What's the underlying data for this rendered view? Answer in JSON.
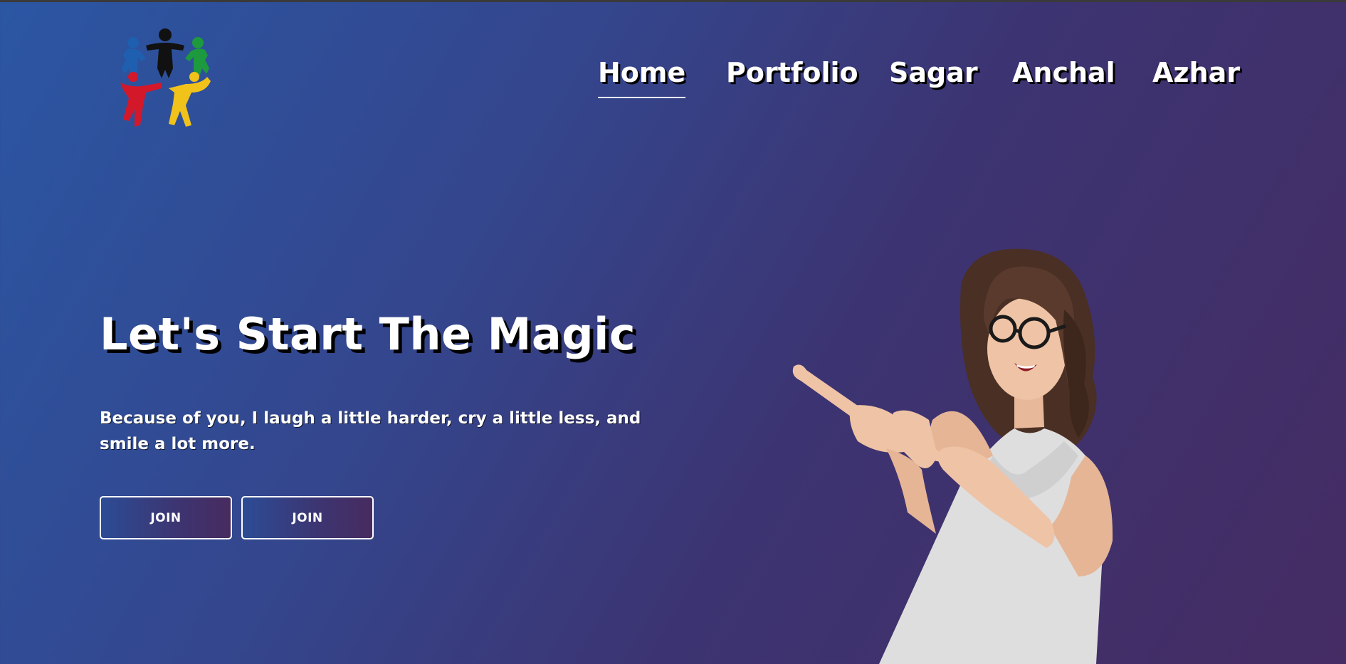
{
  "logo": {
    "icon": "people-circle-logo-icon",
    "colors": [
      "#1f5fb0",
      "#111111",
      "#1d9a3d",
      "#d3182a",
      "#f1c21a"
    ]
  },
  "nav": {
    "items": [
      {
        "label": "Home",
        "active": true
      },
      {
        "label": "Portfolio",
        "active": false
      },
      {
        "label": "Sagar",
        "active": false
      },
      {
        "label": "Anchal",
        "active": false
      },
      {
        "label": "Azhar",
        "active": false
      }
    ]
  },
  "hero": {
    "title": "Let's Start The Magic",
    "subtitle": "Because of you, I laugh a little harder, cry a little less, and smile a lot more.",
    "buttons": [
      {
        "label": "JOIN"
      },
      {
        "label": "JOIN"
      }
    ],
    "image": "woman-pointing-left-image"
  },
  "colors": {
    "background_start": "#2b56a3",
    "background_end": "#452c63",
    "text": "#ffffff",
    "shadow": "#000000"
  }
}
